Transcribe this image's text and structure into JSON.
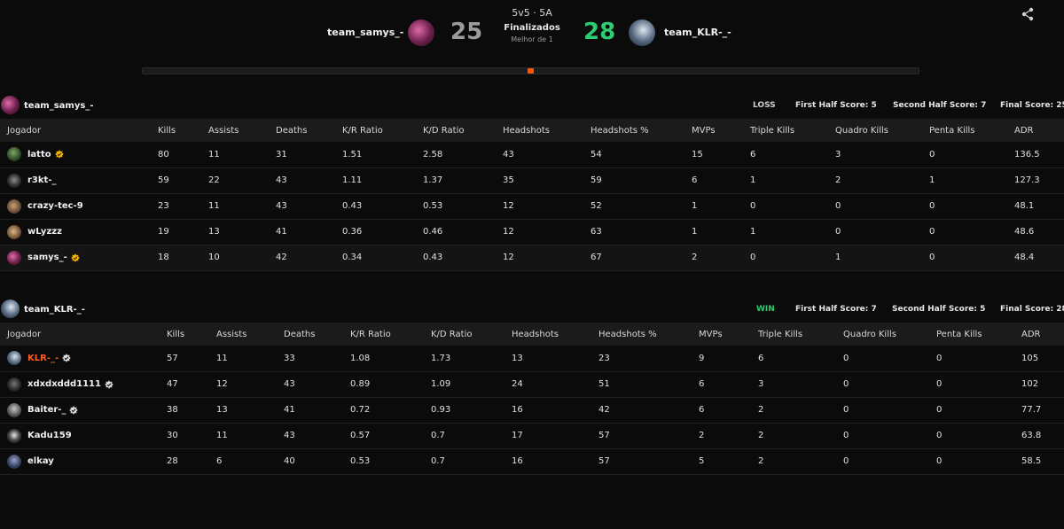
{
  "header": {
    "mode": "5v5 · 5A",
    "status": "Finalizados",
    "best_of": "Melhor de 1",
    "left_team": {
      "name": "team_samys_-",
      "score": "25"
    },
    "right_team": {
      "name": "team_KLR-_-",
      "score": "28"
    },
    "progress": 0.5
  },
  "columns": [
    "Jogador",
    "Kills",
    "Assists",
    "Deaths",
    "K/R Ratio",
    "K/D Ratio",
    "Headshots",
    "Headshots %",
    "MVPs",
    "Triple Kills",
    "Quadro Kills",
    "Penta Kills",
    "ADR"
  ],
  "teams": [
    {
      "name": "team_samys_-",
      "result": "LOSS",
      "first_half": "First Half Score: 5",
      "second_half": "Second Half Score: 7",
      "final": "Final Score: 25",
      "players": [
        {
          "name": "latto",
          "badge": "gold",
          "stats": [
            "80",
            "11",
            "31",
            "1.51",
            "2.58",
            "43",
            "54",
            "15",
            "6",
            "3",
            "0",
            "136.5"
          ]
        },
        {
          "name": "r3kt-_",
          "badge": "",
          "stats": [
            "59",
            "22",
            "43",
            "1.11",
            "1.37",
            "35",
            "59",
            "6",
            "1",
            "2",
            "1",
            "127.3"
          ]
        },
        {
          "name": "crazy-tec-9",
          "badge": "",
          "stats": [
            "23",
            "11",
            "43",
            "0.43",
            "0.53",
            "12",
            "52",
            "1",
            "0",
            "0",
            "0",
            "48.1"
          ]
        },
        {
          "name": "wLyzzz",
          "badge": "",
          "stats": [
            "19",
            "13",
            "41",
            "0.36",
            "0.46",
            "12",
            "63",
            "1",
            "1",
            "0",
            "0",
            "48.6"
          ]
        },
        {
          "name": "samys_-",
          "badge": "gold",
          "stats": [
            "18",
            "10",
            "42",
            "0.34",
            "0.43",
            "12",
            "67",
            "2",
            "0",
            "1",
            "0",
            "48.4"
          ]
        }
      ]
    },
    {
      "name": "team_KLR-_-",
      "result": "WIN",
      "first_half": "First Half Score: 7",
      "second_half": "Second Half Score: 5",
      "final": "Final Score: 28",
      "players": [
        {
          "name": "KLR-_-",
          "badge": "verified",
          "stats": [
            "57",
            "11",
            "33",
            "1.08",
            "1.73",
            "13",
            "23",
            "9",
            "6",
            "0",
            "0",
            "105"
          ]
        },
        {
          "name": "xdxdxddd1111",
          "badge": "verified",
          "stats": [
            "47",
            "12",
            "43",
            "0.89",
            "1.09",
            "24",
            "51",
            "6",
            "3",
            "0",
            "0",
            "102"
          ]
        },
        {
          "name": "Baiter-_",
          "badge": "verified",
          "stats": [
            "38",
            "13",
            "41",
            "0.72",
            "0.93",
            "16",
            "42",
            "6",
            "2",
            "0",
            "0",
            "77.7"
          ]
        },
        {
          "name": "Kadu159",
          "badge": "",
          "stats": [
            "30",
            "11",
            "43",
            "0.57",
            "0.7",
            "17",
            "57",
            "2",
            "2",
            "0",
            "0",
            "63.8"
          ]
        },
        {
          "name": "elkay",
          "badge": "",
          "stats": [
            "28",
            "6",
            "40",
            "0.53",
            "0.7",
            "16",
            "57",
            "5",
            "2",
            "0",
            "0",
            "58.5"
          ]
        }
      ]
    }
  ],
  "colors": {
    "win": "#2ecc71",
    "accent": "#ff5500",
    "highlight_player": "#ff5a1f"
  },
  "icons": {
    "share": "share-icon",
    "gold_badge": "gold-star-badge-icon",
    "verified": "verified-check-icon"
  }
}
